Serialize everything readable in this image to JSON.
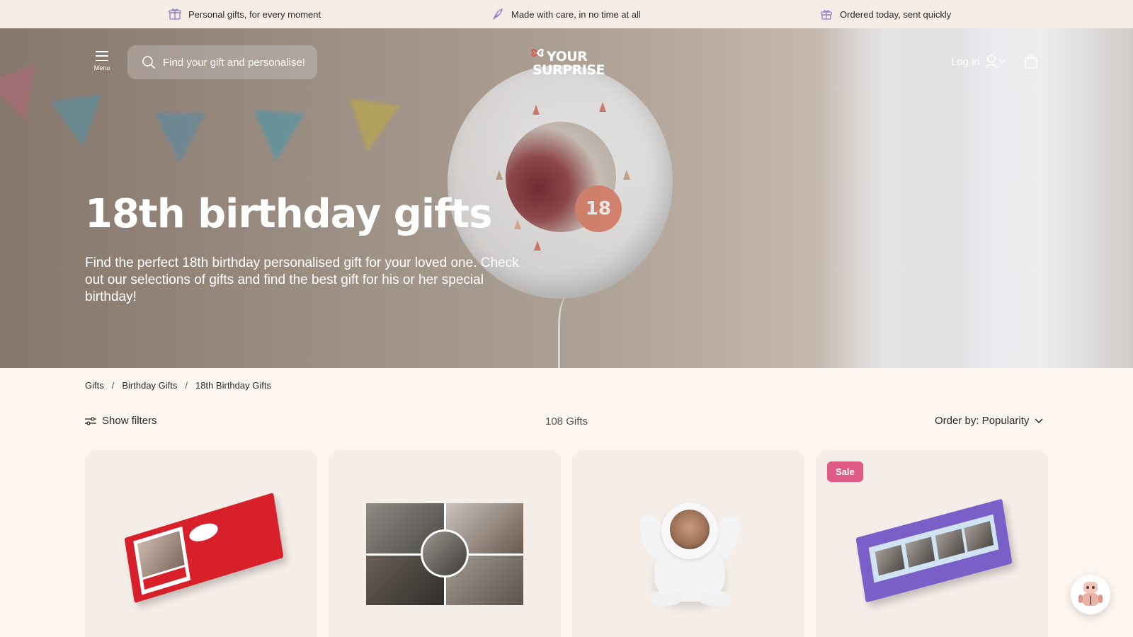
{
  "usp_bar": {
    "items": [
      {
        "text": "Personal gifts, for every moment",
        "icon": "gift-box-icon"
      },
      {
        "text": "Made with care, in no time at all",
        "icon": "feather-icon"
      },
      {
        "text": "Ordered today, sent quickly",
        "icon": "gift-icon"
      }
    ]
  },
  "header": {
    "menu_label": "Menu",
    "search_placeholder": "Find your gift and personalise!",
    "logo_line1": "YOUR",
    "logo_line2": "SURPRISE",
    "login_label": "Log in"
  },
  "hero": {
    "title": "18th birthday gifts",
    "subtitle": "Find the perfect 18th birthday personalised gift for your loved one. Check out our selections of gifts and find the best gift for his or her special birthday!",
    "balloon_number": "18"
  },
  "breadcrumb": [
    "Gifts",
    "Birthday Gifts",
    "18th Birthday Gifts"
  ],
  "toolbar": {
    "filters_label": "Show filters",
    "count_label": "108 Gifts",
    "order_label": "Order by: Popularity"
  },
  "products": [
    {
      "name": "kitkat-personalised-box",
      "badge": ""
    },
    {
      "name": "photo-collage",
      "badge": ""
    },
    {
      "name": "bunny-plush",
      "badge": ""
    },
    {
      "name": "milka-personalised-box",
      "badge": "Sale"
    }
  ],
  "colors": {
    "page_bg": "#fdf5ef",
    "usp_bg": "#f6ece6",
    "card_bg": "#f5ede8",
    "sale_badge": "#e05a86",
    "logo_accent": "#e05a4a"
  }
}
